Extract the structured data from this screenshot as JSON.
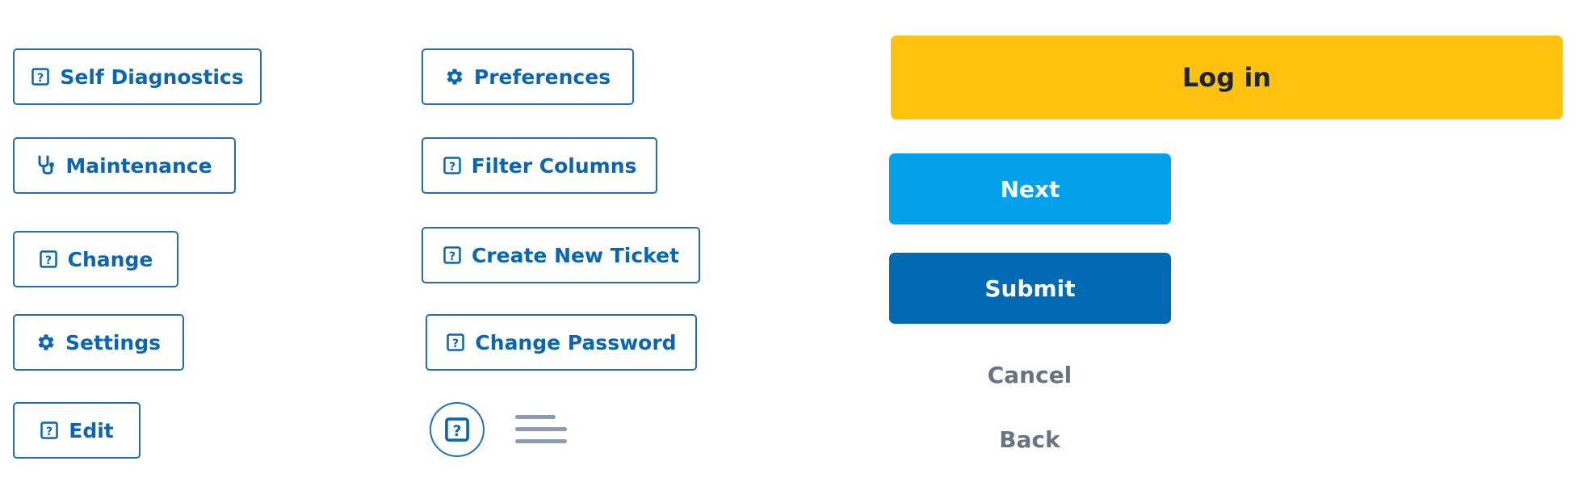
{
  "left_column": {
    "self_diagnostics": "Self Diagnostics",
    "maintenance": "Maintenance",
    "change": "Change",
    "settings": "Settings",
    "edit": "Edit"
  },
  "middle_column": {
    "preferences": "Preferences",
    "filter_columns": "Filter Columns",
    "create_new_ticket": "Create New Ticket",
    "change_password": "Change Password"
  },
  "right_column": {
    "login": "Log in",
    "next": "Next",
    "submit": "Submit",
    "cancel": "Cancel",
    "back": "Back"
  },
  "icons": {
    "help": "help-square-icon",
    "gear": "gear-icon",
    "stethoscope": "stethoscope-icon",
    "menu": "hamburger-menu-icon"
  },
  "colors": {
    "outline_blue": "#1f6fb7",
    "login_yellow": "#ffc20e",
    "next_blue": "#03a0ec",
    "submit_blue": "#006ab4",
    "muted_text": "#6b7380"
  }
}
